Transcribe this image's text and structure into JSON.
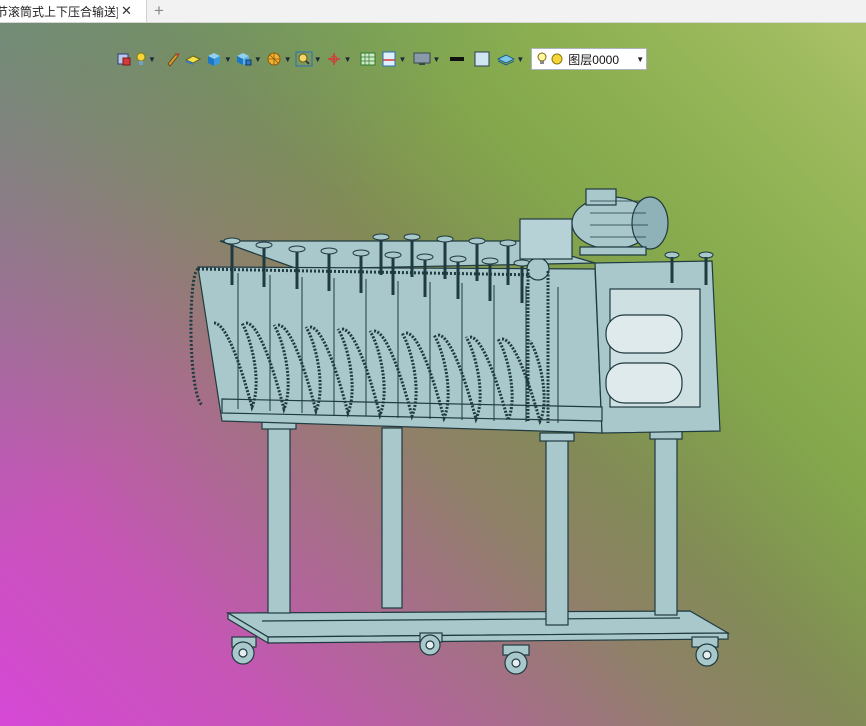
{
  "tab": {
    "title": "节滚筒式上下压合输送]",
    "close_glyph": "✕",
    "add_glyph": "+"
  },
  "toolbar": {
    "items": [
      {
        "icon": "view-cube-icon"
      },
      {
        "icon": "light-bulb-icon",
        "dropdown": true
      },
      {
        "icon": "paint-brush-icon"
      },
      {
        "icon": "material-icon"
      },
      {
        "icon": "shaded-box-icon",
        "dropdown": true
      },
      {
        "icon": "section-view-icon",
        "dropdown": true
      },
      {
        "icon": "render-mode-icon",
        "dropdown": true
      },
      {
        "icon": "zoom-icon",
        "dropdown": true
      },
      {
        "icon": "move-axis-icon",
        "dropdown": true
      },
      {
        "icon": "grid-icon"
      },
      {
        "icon": "ruler-icon",
        "dropdown": true
      },
      {
        "icon": "monitor-icon",
        "dropdown": true
      },
      {
        "icon": "line-weight-icon"
      },
      {
        "icon": "color-swatch-icon"
      },
      {
        "icon": "layers-icon",
        "dropdown": true
      }
    ],
    "layer_combo": {
      "value": "图层0000",
      "icons": [
        "bulb-on-icon",
        "sun-icon"
      ]
    }
  },
  "colors": {
    "model_fill": "#a9c8cc",
    "model_line": "#1f3a40",
    "bg_top_right": "#4d9a1c",
    "bg_bottom_left": "#d648d6",
    "bg_bottom_right": "#bcc878"
  }
}
